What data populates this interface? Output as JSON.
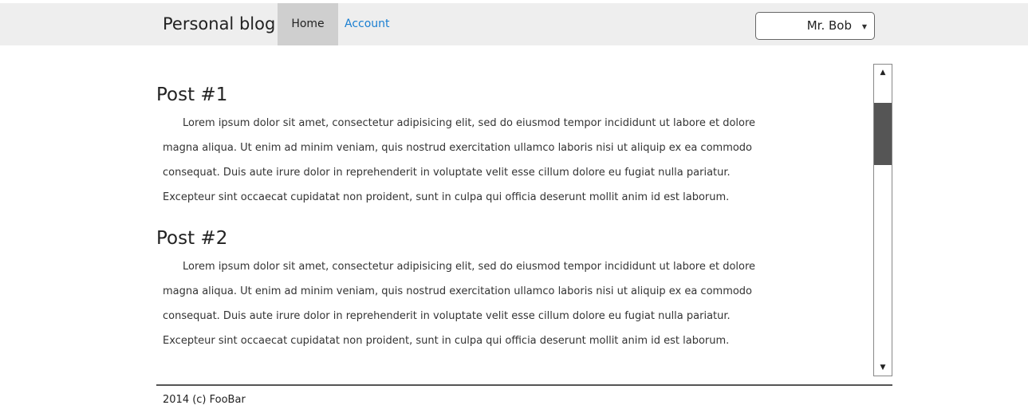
{
  "navbar": {
    "brand": "Personal blog",
    "home_label": "Home",
    "account_label": "Account",
    "user_menu": {
      "selected": "Mr. Bob",
      "chevron_icon": "chevron-down-icon"
    }
  },
  "posts": [
    {
      "title": "Post #1",
      "lines": [
        "Lorem ipsum dolor sit amet, consectetur adipisicing elit, sed do eiusmod tempor incididunt ut labore et dolore",
        "magna aliqua. Ut enim ad minim veniam, quis nostrud exercitation ullamco laboris nisi ut aliquip ex ea commodo",
        "consequat. Duis aute irure dolor in reprehenderit in voluptate velit esse cillum dolore eu fugiat nulla pariatur.",
        "Excepteur sint occaecat cupidatat non proident, sunt in culpa qui officia deserunt mollit anim id est laborum."
      ]
    },
    {
      "title": "Post #2",
      "lines": [
        "Lorem ipsum dolor sit amet, consectetur adipisicing elit, sed do eiusmod tempor incididunt ut labore et dolore",
        "magna aliqua. Ut enim ad minim veniam, quis nostrud exercitation ullamco laboris nisi ut aliquip ex ea commodo",
        "consequat. Duis aute irure dolor in reprehenderit in voluptate velit esse cillum dolore eu fugiat nulla pariatur.",
        "Excepteur sint occaecat cupidatat non proident, sunt in culpa qui officia deserunt mollit anim id est laborum."
      ]
    }
  ],
  "scrollbar": {
    "up_icon": "arrow-up-icon",
    "down_icon": "arrow-down-icon"
  },
  "footer": {
    "text": "2014 (c) FooBar"
  }
}
